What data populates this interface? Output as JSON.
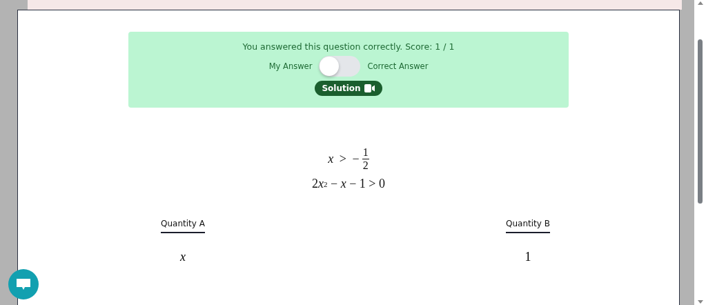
{
  "result": {
    "message": "You answered this question correctly. Score: 1 / 1",
    "toggle": {
      "left_label": "My Answer",
      "right_label": "Correct Answer",
      "on": false
    },
    "solution_button": "Solution"
  },
  "conditions": [
    {
      "kind": "fraction",
      "lhs": "x",
      "op": ">",
      "sign": "−",
      "numerator": "1",
      "denominator": "2"
    },
    {
      "kind": "polynomial",
      "parts": [
        "2",
        "x",
        "2",
        " − ",
        "x",
        " − 1 > 0"
      ]
    }
  ],
  "quantities": [
    {
      "heading": "Quantity A",
      "value": "x",
      "italic": true
    },
    {
      "heading": "Quantity B",
      "value": "1",
      "italic": false
    }
  ]
}
